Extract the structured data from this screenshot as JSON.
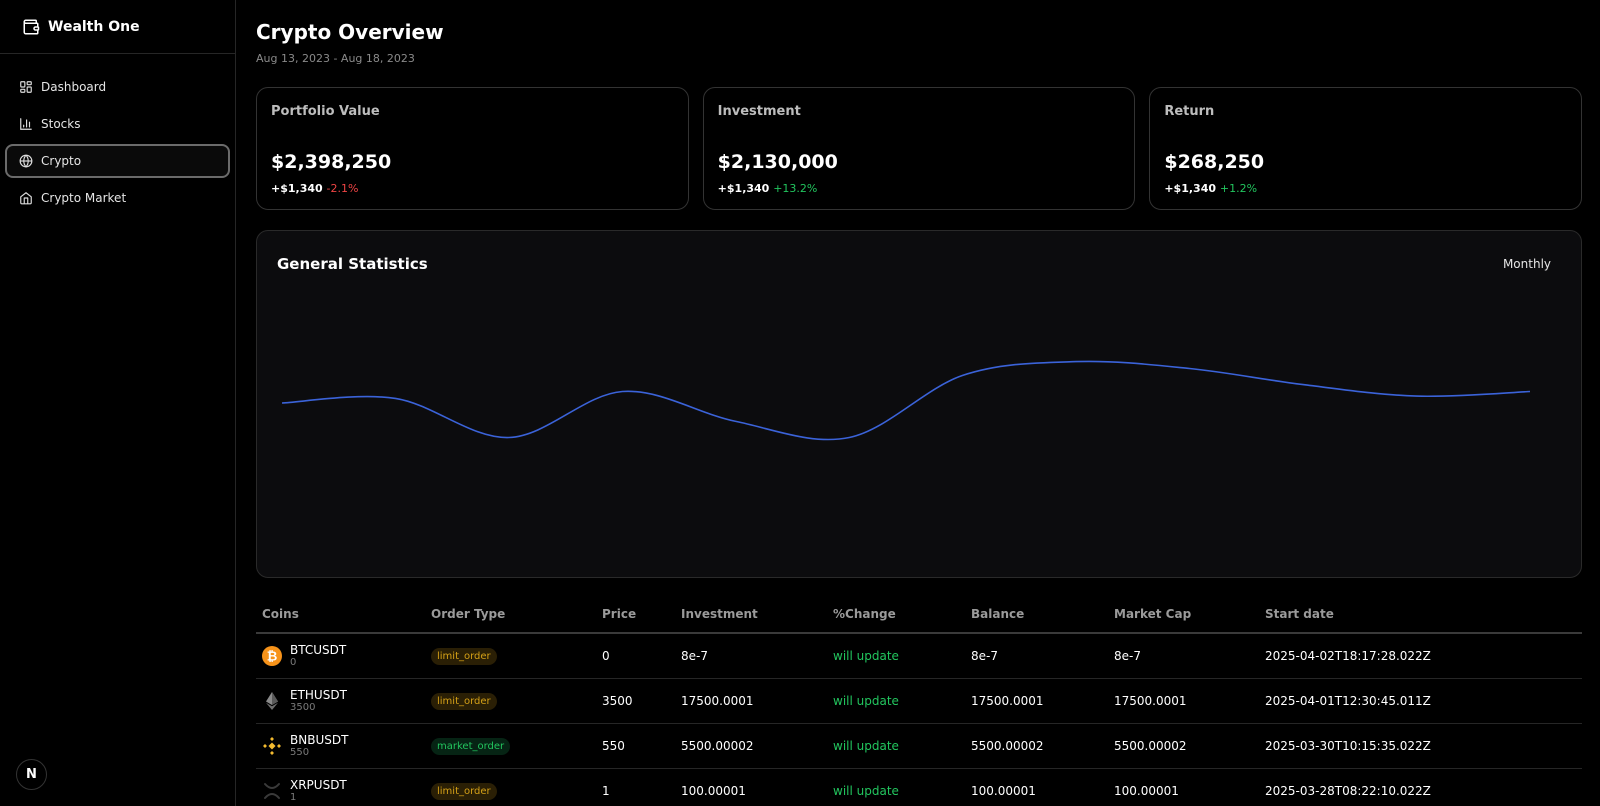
{
  "app": {
    "brand": "Wealth One"
  },
  "sidebar": {
    "items": [
      {
        "label": "Dashboard",
        "icon": "dashboard-icon",
        "active": false
      },
      {
        "label": "Stocks",
        "icon": "bar-chart-icon",
        "active": false
      },
      {
        "label": "Crypto",
        "icon": "globe-icon",
        "active": true
      },
      {
        "label": "Crypto Market",
        "icon": "home-icon",
        "active": false
      }
    ],
    "badge": "N"
  },
  "header": {
    "title": "Crypto Overview",
    "date_range": "Aug 13, 2023 - Aug 18, 2023"
  },
  "cards": [
    {
      "title": "Portfolio Value",
      "value": "$2,398,250",
      "delta": "+$1,340",
      "change": "-2.1%",
      "trend": "down"
    },
    {
      "title": "Investment",
      "value": "$2,130,000",
      "delta": "+$1,340",
      "change": "+13.2%",
      "trend": "up"
    },
    {
      "title": "Return",
      "value": "$268,250",
      "delta": "+$1,340",
      "change": "+1.2%",
      "trend": "up"
    }
  ],
  "chart": {
    "title": "General Statistics",
    "period": "Monthly",
    "line_color": "#3b63d9"
  },
  "chart_data": {
    "type": "line",
    "x": [
      0,
      1,
      2,
      3,
      4,
      5,
      6,
      7,
      8,
      9,
      10,
      11
    ],
    "values": [
      60,
      62,
      45,
      65,
      52,
      45,
      72,
      78,
      75,
      68,
      63,
      65
    ],
    "ylim": [
      0,
      100
    ],
    "grid": false
  },
  "table": {
    "columns": [
      "Coins",
      "Order Type",
      "Price",
      "Investment",
      "%Change",
      "Balance",
      "Market Cap",
      "Start date"
    ],
    "rows": [
      {
        "coin": "BTCUSDT",
        "sub": "0",
        "icon": "bitcoin-icon",
        "order_type": "limit_order",
        "price": "0",
        "investment": "8e-7",
        "change": "will update",
        "balance": "8e-7",
        "market_cap": "8e-7",
        "start_date": "2025-04-02T18:17:28.022Z"
      },
      {
        "coin": "ETHUSDT",
        "sub": "3500",
        "icon": "ethereum-icon",
        "order_type": "limit_order",
        "price": "3500",
        "investment": "17500.0001",
        "change": "will update",
        "balance": "17500.0001",
        "market_cap": "17500.0001",
        "start_date": "2025-04-01T12:30:45.011Z"
      },
      {
        "coin": "BNBUSDT",
        "sub": "550",
        "icon": "bnb-icon",
        "order_type": "market_order",
        "price": "550",
        "investment": "5500.00002",
        "change": "will update",
        "balance": "5500.00002",
        "market_cap": "5500.00002",
        "start_date": "2025-03-30T10:15:35.022Z"
      },
      {
        "coin": "XRPUSDT",
        "sub": "1",
        "icon": "xrp-icon",
        "order_type": "limit_order",
        "price": "1",
        "investment": "100.00001",
        "change": "will update",
        "balance": "100.00001",
        "market_cap": "100.00001",
        "start_date": "2025-03-28T08:22:10.022Z"
      }
    ]
  }
}
